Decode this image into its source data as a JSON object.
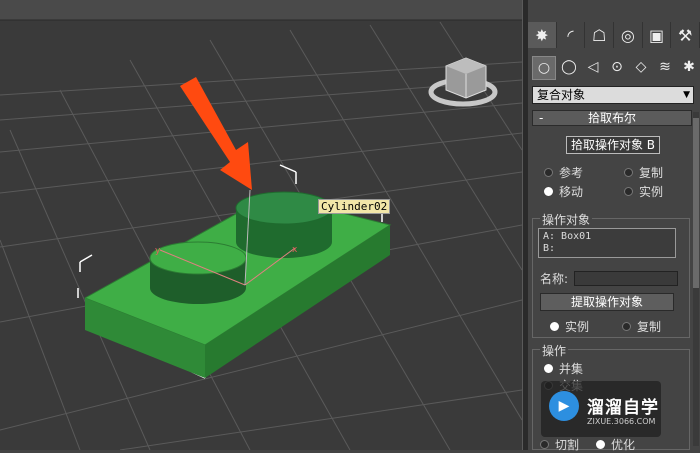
{
  "viewport": {
    "object_label": "Cylinder02",
    "arrow_color": "#ff4a10",
    "box_color": "#3fae46",
    "cylinder_top_color": "#2f8a45"
  },
  "command_panel": {
    "tabs": [
      {
        "name": "create-tab",
        "icon": "✸"
      },
      {
        "name": "modify-tab",
        "icon": "◜"
      },
      {
        "name": "hierarchy-tab",
        "icon": "☖"
      },
      {
        "name": "motion-tab",
        "icon": "◎"
      },
      {
        "name": "display-tab",
        "icon": "▣"
      },
      {
        "name": "utilities-tab",
        "icon": "⚒"
      }
    ],
    "sub_icons": [
      {
        "name": "geometry-icon",
        "icon": "○"
      },
      {
        "name": "shapes-icon",
        "icon": "◯"
      },
      {
        "name": "lights-icon",
        "icon": "◁"
      },
      {
        "name": "cameras-icon",
        "icon": "⊙"
      },
      {
        "name": "helpers-icon",
        "icon": "◇"
      },
      {
        "name": "spacewarps-icon",
        "icon": "≋"
      },
      {
        "name": "systems-icon",
        "icon": "✱"
      }
    ],
    "category_dropdown": "复合对象",
    "rollout_title": "拾取布尔",
    "rollout_collapse": "-",
    "pick_operand_button": "拾取操作对象 B",
    "pick_options": {
      "reference": "参考",
      "copy": "复制",
      "move": "移动",
      "instance": "实例"
    },
    "operands_group_title": "操作对象",
    "operands_list": [
      "A: Box01",
      "B:"
    ],
    "name_label": "名称:",
    "extract_operand_button": "提取操作对象",
    "extract_options": {
      "instance": "实例",
      "copy": "复制"
    },
    "operation_group_title": "操作",
    "operation_options": {
      "union": "并集",
      "intersection": "交集",
      "cut": "切割",
      "optimize": "优化"
    }
  },
  "watermark": {
    "title": "溜溜自学",
    "url": "ZIXUE.3066.COM",
    "icon": "play-icon"
  }
}
